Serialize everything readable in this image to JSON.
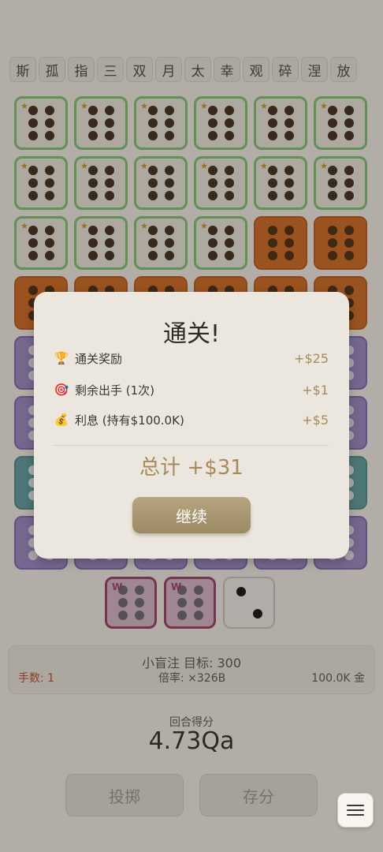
{
  "top_chars": [
    "斯",
    "孤",
    "指",
    "三",
    "双",
    "月",
    "太",
    "幸",
    "观",
    "碎",
    "涅",
    "放"
  ],
  "grid": {
    "rows": [
      [
        "white-green-star",
        "white-green-star",
        "white-green-star",
        "white-green-star",
        "white-green-star",
        "white-green-star"
      ],
      [
        "white-green-star",
        "white-green-star",
        "white-green-star",
        "white-green-star",
        "white-green-star",
        "white-green-star"
      ],
      [
        "white-green-star",
        "white-green-star",
        "white-green-star",
        "white-green-star",
        "orange",
        "orange"
      ],
      [
        "orange",
        "orange",
        "orange",
        "orange",
        "orange",
        "orange"
      ],
      [
        "purple",
        "purple",
        "purple",
        "purple",
        "purple",
        "purple"
      ],
      [
        "purple",
        "purple",
        "purple",
        "purple",
        "purple",
        "purple"
      ],
      [
        "teal",
        "teal",
        "teal",
        "teal",
        "teal",
        "teal"
      ],
      [
        "purple",
        "purple",
        "purple",
        "purple",
        "purple",
        "purple"
      ]
    ],
    "pip_count": 6
  },
  "hand": [
    {
      "style": "pink",
      "pips": 6,
      "mark": "W"
    },
    {
      "style": "pink",
      "pips": 6,
      "mark": "W"
    },
    {
      "style": "plain",
      "pips": 2
    }
  ],
  "info": {
    "blind": "小盲注  目标: 300",
    "hands_left": "手数: 1",
    "multiplier": "倍率: ×326B",
    "money": "100.0K 金"
  },
  "round": {
    "label": "回合得分",
    "score": "4.73Qa"
  },
  "buttons": {
    "roll": "投掷",
    "save": "存分"
  },
  "modal": {
    "title": "通关!",
    "rewards": [
      {
        "icon": "trophy-icon",
        "glyph": "🏆",
        "label": "通关奖励",
        "value": "+$25"
      },
      {
        "icon": "target-icon",
        "glyph": "🎯",
        "label": "剩余出手 (1次)",
        "value": "+$1"
      },
      {
        "icon": "money-bag-icon",
        "glyph": "💰",
        "label": "利息 (持有$100.0K)",
        "value": "+$5"
      }
    ],
    "total": "总计  +$31",
    "continue_label": "继续"
  },
  "colors": {
    "accent_gold": "#a68a5a",
    "button_gold": "#b6a47e",
    "die_green_border": "#7cc46c",
    "die_orange": "#d0691f",
    "die_purple": "#9b86c4",
    "die_teal": "#5f9ea0"
  }
}
